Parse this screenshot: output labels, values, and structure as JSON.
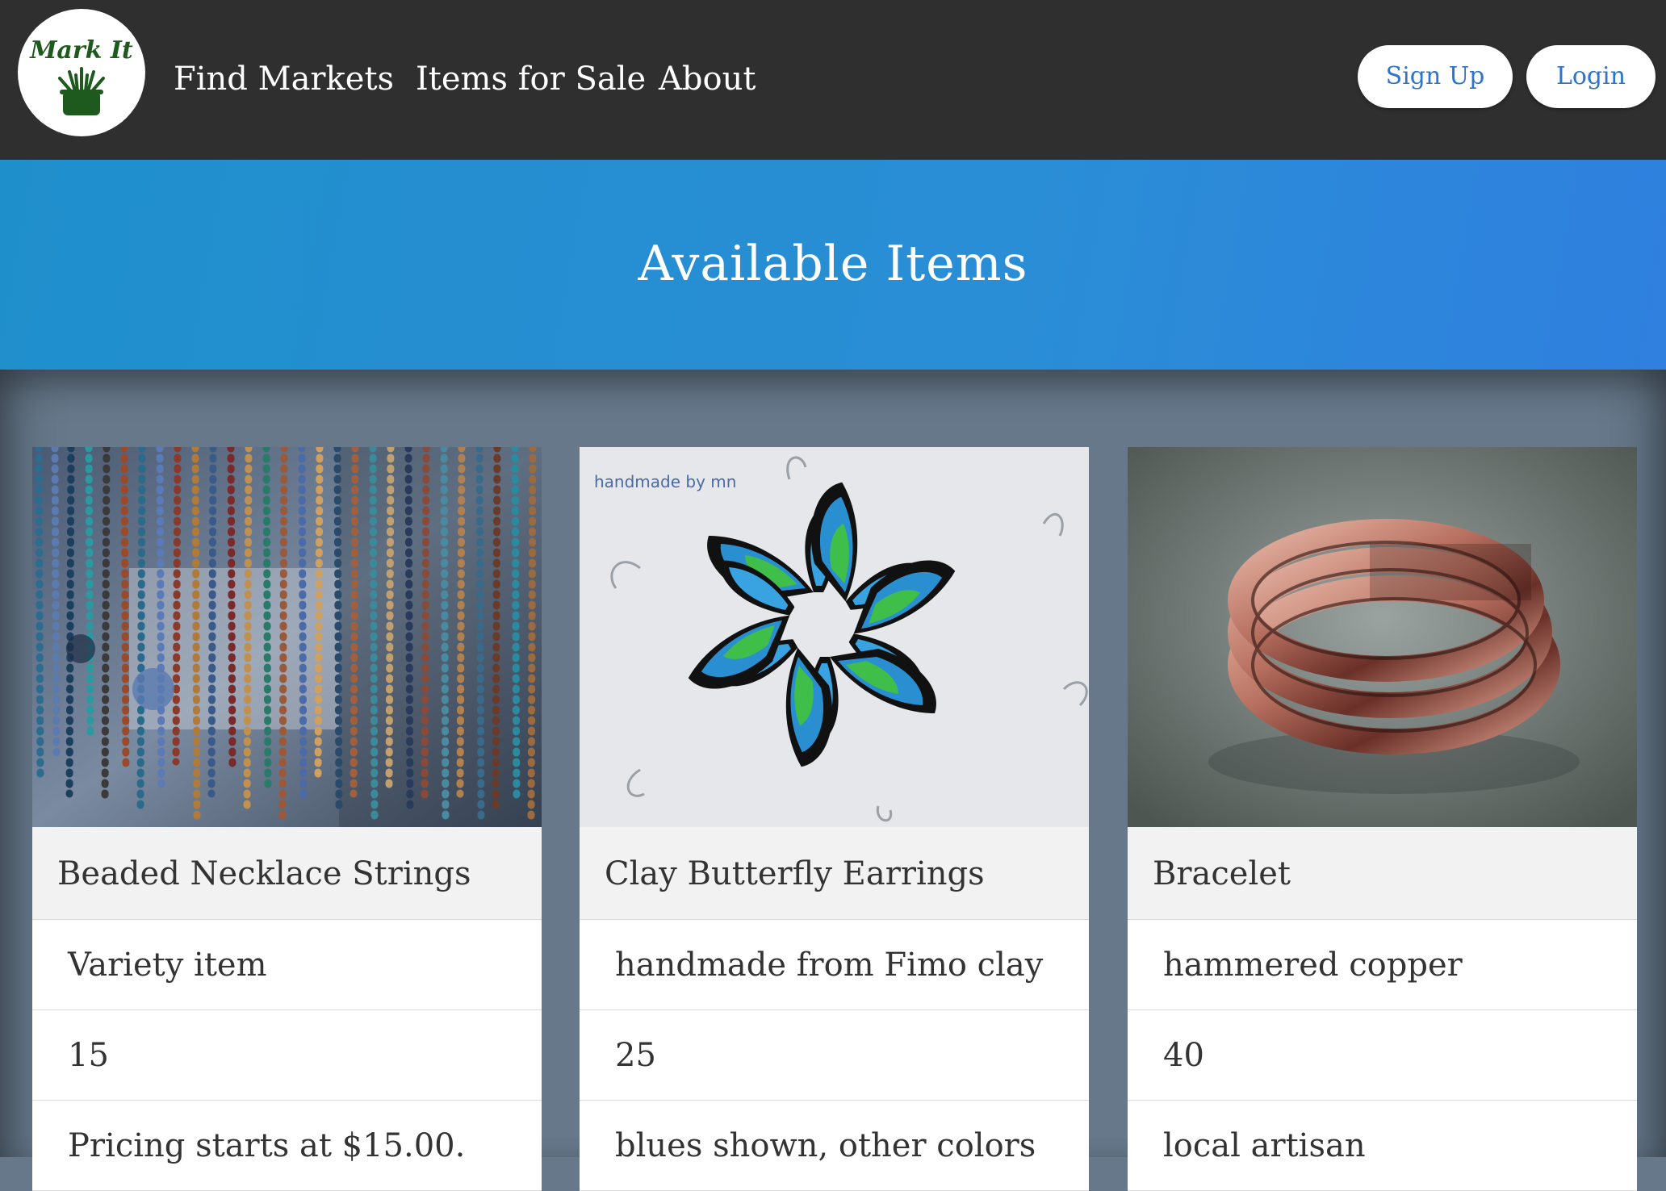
{
  "brand": {
    "logo_text": "Mark It"
  },
  "nav": {
    "links": [
      "Find Markets",
      "Items for Sale",
      "About"
    ],
    "signup_label": "Sign Up",
    "login_label": "Login"
  },
  "hero": {
    "title": "Available Items"
  },
  "items": [
    {
      "title": "Beaded Necklace Strings",
      "description": "Variety item",
      "quantity": "15",
      "note": "Pricing starts at $15.00."
    },
    {
      "title": "Clay Butterfly Earrings",
      "description": "handmade from Fimo clay",
      "quantity": "25",
      "note": "blues shown, other colors",
      "image_watermark": "handmade by mn"
    },
    {
      "title": "Bracelet",
      "description": "hammered copper",
      "quantity": "40",
      "note": "local artisan"
    }
  ],
  "colors": {
    "navbar": "#2f2f2f",
    "hero": "#2a8ed6",
    "content_bg": "#66788a",
    "accent_link": "#2f74c9",
    "logo_green": "#1e5a1e"
  }
}
